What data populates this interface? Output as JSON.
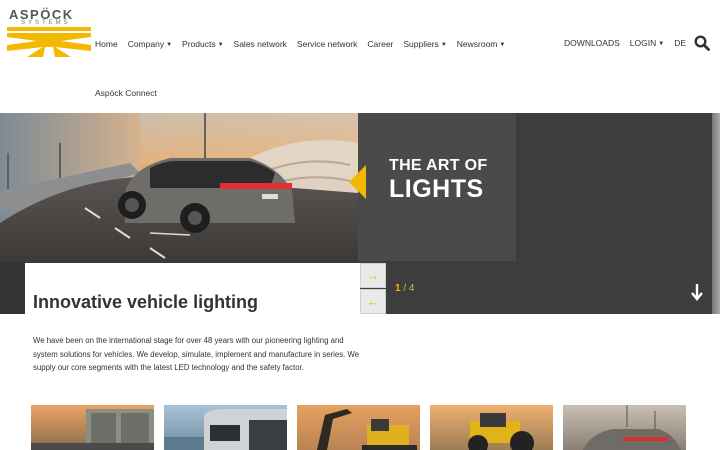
{
  "brand": {
    "name": "ASPÖCK",
    "sub": "SYSTEMS"
  },
  "nav": {
    "items": [
      {
        "label": "Home",
        "dropdown": false
      },
      {
        "label": "Company",
        "dropdown": true
      },
      {
        "label": "Products",
        "dropdown": true
      },
      {
        "label": "Sales network",
        "dropdown": false
      },
      {
        "label": "Service network",
        "dropdown": false
      },
      {
        "label": "Career",
        "dropdown": false
      },
      {
        "label": "Suppliers",
        "dropdown": true
      },
      {
        "label": "Newsroom",
        "dropdown": true
      }
    ],
    "second_row": "Aspöck Connect",
    "downloads": "DOWNLOADS",
    "login": "LOGIN",
    "language": "DE"
  },
  "hero": {
    "title_line1": "THE ART OF",
    "title_line2": "LIGHTS",
    "caption": "Innovative vehicle lighting",
    "slide_current": "1",
    "slide_separator": "/",
    "slide_total": "4",
    "next_arrow": "→",
    "prev_arrow": "←",
    "accent": "#f5b800"
  },
  "intro": {
    "text": "We have been on the international stage for over 48 years with our pioneering lighting and system solutions for vehicles. We develop, simulate, implement and manufacture in series. We supply our core segments with the latest LED technology and the safety factor."
  },
  "tiles": [
    {
      "name": "trailer-tile",
      "icon": "truck-trailer"
    },
    {
      "name": "truck-tile",
      "icon": "truck"
    },
    {
      "name": "excavator-tile",
      "icon": "excavator"
    },
    {
      "name": "tractor-tile",
      "icon": "tractor"
    },
    {
      "name": "car-tile",
      "icon": "car"
    }
  ],
  "colors": {
    "accent": "#f5b800",
    "dark_panel": "#3d3d3d",
    "text": "#333333"
  }
}
